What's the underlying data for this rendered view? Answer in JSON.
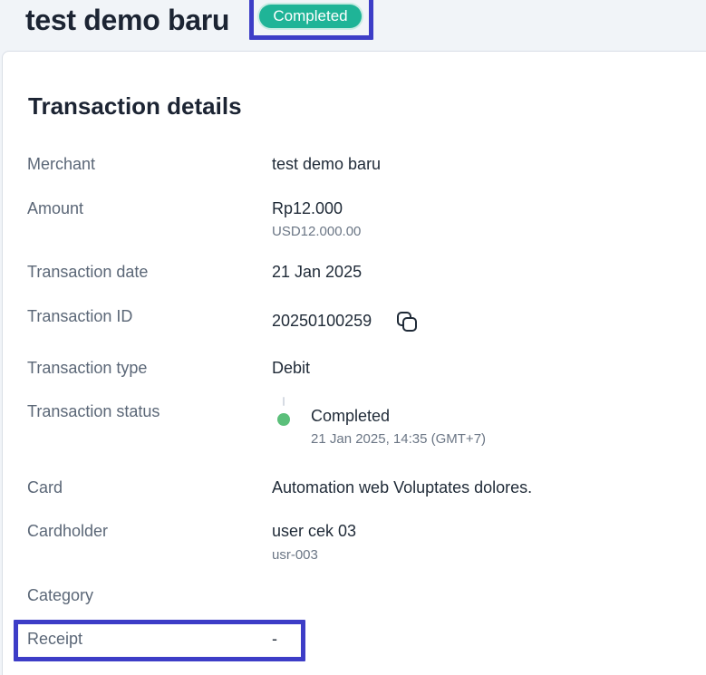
{
  "header": {
    "merchant_name": "test demo baru",
    "status_badge": "Completed"
  },
  "details": {
    "title": "Transaction details",
    "merchant": {
      "label": "Merchant",
      "value": "test demo baru"
    },
    "amount": {
      "label": "Amount",
      "value": "Rp12.000",
      "secondary": "USD12.000.00"
    },
    "transaction_date": {
      "label": "Transaction date",
      "value": "21 Jan 2025"
    },
    "transaction_id": {
      "label": "Transaction ID",
      "value": "20250100259",
      "action_icon": "copy-icon"
    },
    "transaction_type": {
      "label": "Transaction type",
      "value": "Debit"
    },
    "transaction_status": {
      "label": "Transaction status",
      "status": "Completed",
      "timestamp": "21 Jan 2025, 14:35 (GMT+7)",
      "dot_color": "#5bbf7a"
    },
    "card": {
      "label": "Card",
      "value": "Automation web Voluptates dolores."
    },
    "cardholder": {
      "label": "Cardholder",
      "value": "user cek 03",
      "secondary": "usr-003"
    },
    "category": {
      "label": "Category",
      "value": ""
    },
    "receipt": {
      "label": "Receipt",
      "value": "-"
    }
  },
  "colors": {
    "accent_badge": "#1fb497",
    "highlight": "#3d3dc7"
  }
}
